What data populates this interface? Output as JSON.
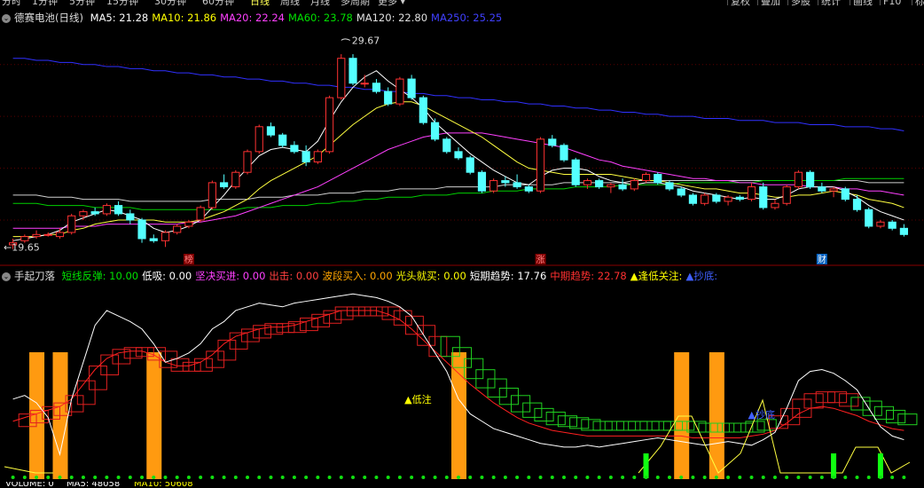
{
  "toolbar": {
    "periods": [
      "分时",
      "1分钟",
      "5分钟",
      "15分钟",
      "30分钟",
      "60分钟",
      "日线",
      "周线",
      "月线",
      "多周期",
      "更多"
    ],
    "active": "日线",
    "right_buttons": [
      "复权",
      "叠加",
      "多股",
      "统计",
      "画线",
      "F10",
      "标"
    ]
  },
  "price_panel": {
    "title": "德赛电池(日线)",
    "ma_labels": [
      {
        "text": "MA5: 21.28",
        "color": "#ffffff"
      },
      {
        "text": "MA10: 21.86",
        "color": "#ffff00"
      },
      {
        "text": "MA20: 22.24",
        "color": "#ff40ff"
      },
      {
        "text": "MA60: 23.78",
        "color": "#00e000"
      },
      {
        "text": "MA120: 22.80",
        "color": "#e0e0e0"
      },
      {
        "text": "MA250: 25.25",
        "color": "#4040ff"
      }
    ],
    "high_label": "29.67",
    "low_label": "19.65",
    "markers": [
      {
        "text": "榜",
        "color": "#ff8080",
        "bg": "#800000"
      },
      {
        "text": "涨",
        "color": "#ff8080",
        "bg": "#800000"
      },
      {
        "text": "财",
        "color": "#ffffff",
        "bg": "#0060c0"
      }
    ]
  },
  "indicator_panel": {
    "title": "手起刀落",
    "labels": [
      {
        "text": "短线反弹: 10.00",
        "color": "#00e000"
      },
      {
        "text": "低吸: 0.00",
        "color": "#ffffff"
      },
      {
        "text": "坚决买进: 0.00",
        "color": "#ff40ff"
      },
      {
        "text": "出击: 0.00",
        "color": "#ff4040"
      },
      {
        "text": "波段买入: 0.00",
        "color": "#ffa500"
      },
      {
        "text": "光头就买: 0.00",
        "color": "#ffff00"
      },
      {
        "text": "短期趋势: 17.76",
        "color": "#ffffff"
      },
      {
        "text": "中期趋势: 22.78",
        "color": "#ff3030"
      },
      {
        "text": "▲逢低关注:",
        "color": "#ffff00"
      },
      {
        "text": "▲抄底:",
        "color": "#4060ff"
      }
    ],
    "annotations": [
      {
        "text": "▲低注",
        "color": "#ffff00"
      },
      {
        "text": "▲抄底",
        "color": "#4060ff"
      }
    ]
  },
  "volume_panel": {
    "labels": [
      {
        "text": "VOLUME: 0",
        "color": "#ffffff"
      },
      {
        "text": "MA5: 48058",
        "color": "#ffffff"
      },
      {
        "text": "MA10: 50608",
        "color": "#ffff00"
      }
    ]
  },
  "chart_data": [
    {
      "type": "candlestick",
      "series_name": "德赛电池(日线)",
      "ylim": [
        19.2,
        30.5
      ],
      "high_marker": 29.67,
      "low_marker": 19.65,
      "candles": [
        [
          19.8,
          20.1,
          19.6,
          19.9
        ],
        [
          20.0,
          20.3,
          19.9,
          20.2
        ],
        [
          20.2,
          20.5,
          20.1,
          20.3
        ],
        [
          20.3,
          20.4,
          20.2,
          20.3
        ],
        [
          20.2,
          20.6,
          20.1,
          20.4
        ],
        [
          20.4,
          21.3,
          20.3,
          21.2
        ],
        [
          21.2,
          21.5,
          21.0,
          21.4
        ],
        [
          21.4,
          21.6,
          21.2,
          21.3
        ],
        [
          21.3,
          21.8,
          21.2,
          21.7
        ],
        [
          21.7,
          21.9,
          21.2,
          21.3
        ],
        [
          21.3,
          21.5,
          20.8,
          21.0
        ],
        [
          21.0,
          21.1,
          19.9,
          20.1
        ],
        [
          20.1,
          20.3,
          19.9,
          20.0
        ],
        [
          20.0,
          20.5,
          19.7,
          20.4
        ],
        [
          20.4,
          20.8,
          20.3,
          20.7
        ],
        [
          20.7,
          21.0,
          20.6,
          20.9
        ],
        [
          21.0,
          21.7,
          20.9,
          21.6
        ],
        [
          21.6,
          22.9,
          21.5,
          22.8
        ],
        [
          22.8,
          23.2,
          22.5,
          22.6
        ],
        [
          22.6,
          23.4,
          22.5,
          23.3
        ],
        [
          23.3,
          24.4,
          23.2,
          24.3
        ],
        [
          24.3,
          25.6,
          24.2,
          25.5
        ],
        [
          25.5,
          25.7,
          25.0,
          25.1
        ],
        [
          25.1,
          25.2,
          24.5,
          24.6
        ],
        [
          24.6,
          24.8,
          24.2,
          24.3
        ],
        [
          24.3,
          24.6,
          23.6,
          23.8
        ],
        [
          23.8,
          24.4,
          23.7,
          24.3
        ],
        [
          24.3,
          27.0,
          24.2,
          26.9
        ],
        [
          26.9,
          29.0,
          26.8,
          28.8
        ],
        [
          28.8,
          29.0,
          27.5,
          27.6
        ],
        [
          27.6,
          28.0,
          27.4,
          27.6
        ],
        [
          27.6,
          27.8,
          27.1,
          27.2
        ],
        [
          27.2,
          27.4,
          26.5,
          26.6
        ],
        [
          26.6,
          27.9,
          26.5,
          27.8
        ],
        [
          27.8,
          28.0,
          26.8,
          26.9
        ],
        [
          26.9,
          27.0,
          25.6,
          25.7
        ],
        [
          25.7,
          25.9,
          24.8,
          24.9
        ],
        [
          24.9,
          25.0,
          24.2,
          24.3
        ],
        [
          24.3,
          24.5,
          23.9,
          24.0
        ],
        [
          24.0,
          24.1,
          23.2,
          23.3
        ],
        [
          23.3,
          23.4,
          22.3,
          22.4
        ],
        [
          22.4,
          23.0,
          22.3,
          22.9
        ],
        [
          22.9,
          23.1,
          22.6,
          22.8
        ],
        [
          22.8,
          23.2,
          22.5,
          22.6
        ],
        [
          22.6,
          22.7,
          22.3,
          22.4
        ],
        [
          22.4,
          25.0,
          22.3,
          24.9
        ],
        [
          24.9,
          25.1,
          24.5,
          24.6
        ],
        [
          24.6,
          24.7,
          23.8,
          23.9
        ],
        [
          23.9,
          24.0,
          22.6,
          22.7
        ],
        [
          22.7,
          23.0,
          22.5,
          22.9
        ],
        [
          22.9,
          23.0,
          22.5,
          22.6
        ],
        [
          22.6,
          22.8,
          22.3,
          22.7
        ],
        [
          22.7,
          23.0,
          22.4,
          22.5
        ],
        [
          22.5,
          23.0,
          22.4,
          22.9
        ],
        [
          22.9,
          23.3,
          22.8,
          23.2
        ],
        [
          23.2,
          23.3,
          22.7,
          22.8
        ],
        [
          22.8,
          22.9,
          22.4,
          22.5
        ],
        [
          22.5,
          22.6,
          22.1,
          22.2
        ],
        [
          22.2,
          22.3,
          21.7,
          21.8
        ],
        [
          21.8,
          22.3,
          21.7,
          22.2
        ],
        [
          22.2,
          22.3,
          21.8,
          21.9
        ],
        [
          21.9,
          22.2,
          21.7,
          22.1
        ],
        [
          22.1,
          22.2,
          21.9,
          22.0
        ],
        [
          22.0,
          22.8,
          21.9,
          22.6
        ],
        [
          22.6,
          22.8,
          21.5,
          21.6
        ],
        [
          21.6,
          22.0,
          21.5,
          21.8
        ],
        [
          21.8,
          22.7,
          21.7,
          22.6
        ],
        [
          22.6,
          23.4,
          22.5,
          23.3
        ],
        [
          23.3,
          23.4,
          22.5,
          22.6
        ],
        [
          22.6,
          22.8,
          22.3,
          22.4
        ],
        [
          22.4,
          22.6,
          22.1,
          22.5
        ],
        [
          22.5,
          22.6,
          21.9,
          22.0
        ],
        [
          22.0,
          22.2,
          21.4,
          21.5
        ],
        [
          21.5,
          21.6,
          20.6,
          20.7
        ],
        [
          20.7,
          21.0,
          20.6,
          20.9
        ],
        [
          20.9,
          21.0,
          20.5,
          20.6
        ],
        [
          20.6,
          20.8,
          20.2,
          20.3
        ]
      ],
      "ma5": [
        20.0,
        20.1,
        20.2,
        20.3,
        20.5,
        20.9,
        21.1,
        21.3,
        21.5,
        21.4,
        21.2,
        21.0,
        20.6,
        20.4,
        20.5,
        20.7,
        21.0,
        21.6,
        22.2,
        22.9,
        23.5,
        24.1,
        24.4,
        24.5,
        24.4,
        24.3,
        24.8,
        25.8,
        26.7,
        27.4,
        27.9,
        28.2,
        27.7,
        27.3,
        26.9,
        26.4,
        25.7,
        25.2,
        24.7,
        24.2,
        23.8,
        23.4,
        23.1,
        22.8,
        22.7,
        23.1,
        23.4,
        23.5,
        23.5,
        23.4,
        23.1,
        22.9,
        22.8,
        22.7,
        22.8,
        22.8,
        22.7,
        22.6,
        22.4,
        22.3,
        22.2,
        22.1,
        22.0,
        22.1,
        22.0,
        22.0,
        22.2,
        22.5,
        22.6,
        22.6,
        22.6,
        22.4,
        22.1,
        21.7,
        21.4,
        21.2,
        21.0
      ],
      "ma10": [
        20.2,
        20.2,
        20.2,
        20.3,
        20.3,
        20.5,
        20.6,
        20.8,
        20.9,
        21.0,
        21.0,
        21.0,
        21.0,
        20.9,
        20.9,
        20.9,
        21.0,
        21.2,
        21.4,
        21.7,
        22.0,
        22.5,
        22.9,
        23.2,
        23.5,
        23.8,
        24.1,
        24.6,
        25.1,
        25.6,
        26.0,
        26.4,
        26.6,
        26.7,
        26.7,
        26.5,
        26.2,
        25.9,
        25.6,
        25.3,
        25.0,
        24.6,
        24.2,
        23.8,
        23.5,
        23.4,
        23.3,
        23.2,
        23.2,
        23.2,
        23.2,
        23.2,
        23.1,
        23.0,
        22.9,
        22.9,
        22.8,
        22.7,
        22.6,
        22.5,
        22.5,
        22.4,
        22.3,
        22.3,
        22.2,
        22.1,
        22.1,
        22.2,
        22.2,
        22.3,
        22.4,
        22.3,
        22.2,
        22.0,
        21.9,
        21.8,
        21.6
      ],
      "ma20": [
        20.6,
        20.6,
        20.6,
        20.6,
        20.6,
        20.7,
        20.7,
        20.7,
        20.8,
        20.8,
        20.8,
        20.8,
        20.8,
        20.8,
        20.8,
        20.9,
        20.9,
        21.0,
        21.1,
        21.2,
        21.4,
        21.6,
        21.8,
        22.0,
        22.2,
        22.4,
        22.6,
        22.9,
        23.2,
        23.5,
        23.8,
        24.1,
        24.4,
        24.6,
        24.8,
        25.0,
        25.1,
        25.2,
        25.2,
        25.2,
        25.2,
        25.1,
        25.0,
        24.9,
        24.8,
        24.7,
        24.6,
        24.5,
        24.3,
        24.1,
        23.9,
        23.8,
        23.6,
        23.5,
        23.4,
        23.3,
        23.2,
        23.1,
        23.0,
        23.0,
        22.9,
        22.9,
        22.8,
        22.8,
        22.7,
        22.7,
        22.7,
        22.7,
        22.6,
        22.6,
        22.6,
        22.5,
        22.5,
        22.4,
        22.4,
        22.3,
        22.2
      ],
      "ma60": [
        21.8,
        21.8,
        21.8,
        21.7,
        21.7,
        21.7,
        21.7,
        21.6,
        21.6,
        21.6,
        21.6,
        21.5,
        21.5,
        21.5,
        21.5,
        21.5,
        21.5,
        21.5,
        21.5,
        21.5,
        21.6,
        21.6,
        21.6,
        21.7,
        21.7,
        21.7,
        21.8,
        21.8,
        21.9,
        21.9,
        22.0,
        22.0,
        22.1,
        22.1,
        22.1,
        22.2,
        22.2,
        22.2,
        22.3,
        22.3,
        22.3,
        22.4,
        22.4,
        22.4,
        22.5,
        22.5,
        22.5,
        22.5,
        22.6,
        22.6,
        22.6,
        22.6,
        22.7,
        22.7,
        22.7,
        22.7,
        22.7,
        22.8,
        22.8,
        22.8,
        22.8,
        22.8,
        22.8,
        22.8,
        22.9,
        22.9,
        22.9,
        22.9,
        22.9,
        22.9,
        22.9,
        23.0,
        23.0,
        23.0,
        23.0,
        23.0,
        23.0
      ],
      "ma120": [
        22.2,
        22.2,
        22.2,
        22.1,
        22.1,
        22.1,
        22.0,
        22.0,
        22.0,
        22.0,
        21.9,
        21.9,
        21.9,
        21.9,
        21.9,
        21.9,
        21.9,
        22.0,
        22.0,
        22.0,
        22.0,
        22.1,
        22.1,
        22.1,
        22.2,
        22.2,
        22.2,
        22.3,
        22.3,
        22.3,
        22.4,
        22.4,
        22.4,
        22.5,
        22.5,
        22.5,
        22.5,
        22.6,
        22.6,
        22.6,
        22.6,
        22.6,
        22.7,
        22.7,
        22.7,
        22.7,
        22.7,
        22.8,
        22.8,
        22.8,
        22.8,
        22.8,
        22.8,
        22.9,
        22.9,
        22.9,
        22.9,
        22.9,
        22.9,
        22.9,
        22.9,
        22.9,
        22.9,
        22.9,
        22.9,
        22.9,
        22.9,
        22.9,
        22.9,
        22.9,
        22.9,
        22.9,
        22.9,
        22.8,
        22.8,
        22.8,
        22.8
      ],
      "ma250": [
        28.8,
        28.8,
        28.7,
        28.7,
        28.6,
        28.6,
        28.5,
        28.5,
        28.4,
        28.4,
        28.3,
        28.3,
        28.2,
        28.2,
        28.1,
        28.1,
        28.0,
        28.0,
        27.9,
        27.9,
        27.8,
        27.8,
        27.7,
        27.7,
        27.6,
        27.6,
        27.5,
        27.5,
        27.4,
        27.4,
        27.3,
        27.3,
        27.2,
        27.2,
        27.1,
        27.1,
        27.0,
        27.0,
        26.9,
        26.9,
        26.8,
        26.8,
        26.7,
        26.7,
        26.6,
        26.6,
        26.5,
        26.5,
        26.4,
        26.4,
        26.3,
        26.3,
        26.2,
        26.2,
        26.1,
        26.1,
        26.0,
        26.0,
        26.0,
        25.9,
        25.9,
        25.9,
        25.8,
        25.8,
        25.8,
        25.7,
        25.7,
        25.7,
        25.6,
        25.6,
        25.6,
        25.5,
        25.5,
        25.5,
        25.4,
        25.4,
        25.3
      ]
    },
    {
      "type": "line",
      "series_name": "手起刀落",
      "ylim": [
        0,
        100
      ],
      "short_trend": [
        40,
        42,
        38,
        30,
        10,
        40,
        60,
        80,
        88,
        85,
        82,
        78,
        70,
        60,
        62,
        65,
        70,
        78,
        82,
        88,
        90,
        92,
        91,
        90,
        92,
        93,
        94,
        95,
        96,
        97,
        96,
        95,
        93,
        90,
        85,
        75,
        65,
        55,
        40,
        32,
        28,
        24,
        22,
        20,
        18,
        16,
        15,
        14,
        14,
        15,
        14,
        15,
        16,
        17,
        18,
        19,
        18,
        17,
        16,
        15,
        16,
        17,
        16,
        15,
        18,
        22,
        35,
        50,
        55,
        56,
        54,
        50,
        45,
        35,
        25,
        20,
        18
      ],
      "mid_trend": [
        28,
        30,
        32,
        34,
        36,
        40,
        48,
        56,
        62,
        65,
        66,
        66,
        64,
        60,
        58,
        58,
        60,
        64,
        70,
        74,
        76,
        78,
        79,
        79,
        80,
        82,
        84,
        86,
        88,
        88,
        88,
        88,
        86,
        83,
        78,
        72,
        66,
        60,
        54,
        48,
        43,
        38,
        34,
        30,
        27,
        25,
        23,
        22,
        21,
        20,
        20,
        20,
        20,
        20,
        20,
        20,
        20,
        20,
        19,
        19,
        19,
        19,
        19,
        20,
        21,
        23,
        27,
        32,
        35,
        36,
        35,
        33,
        31,
        28,
        26,
        24,
        23
      ],
      "signal_bars_x": [
        2,
        4,
        12,
        38,
        57,
        60
      ],
      "green_bars_x": [
        54,
        70,
        74
      ]
    }
  ]
}
